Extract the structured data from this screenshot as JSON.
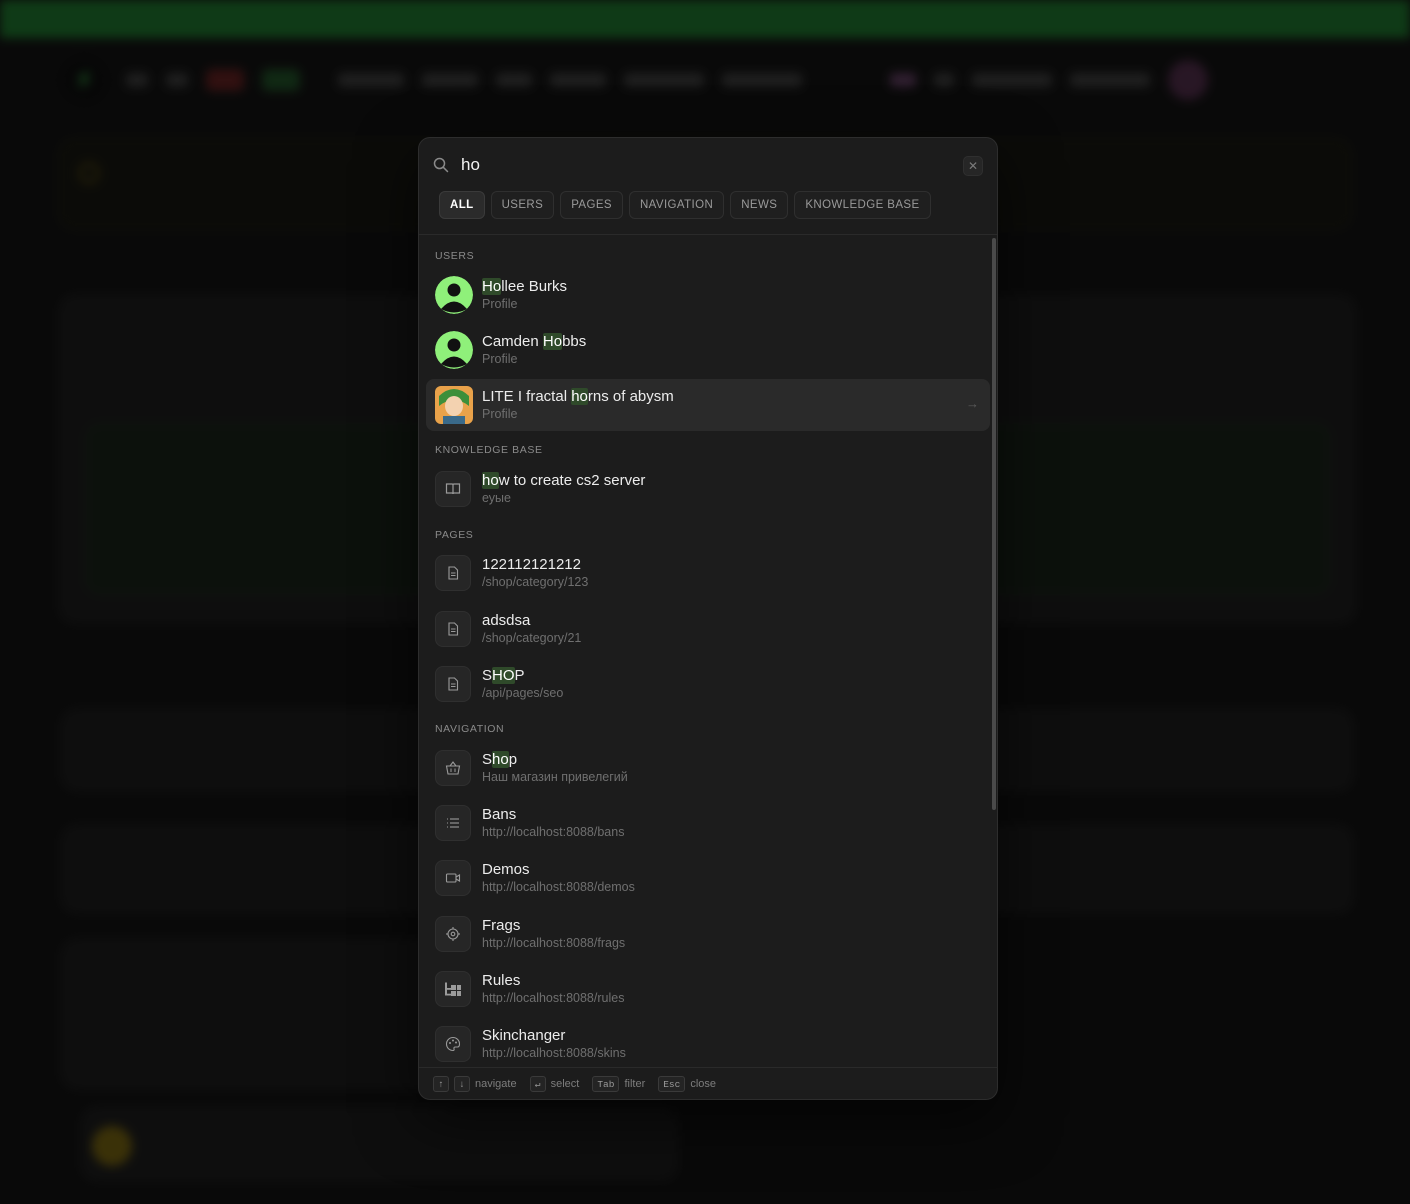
{
  "search": {
    "value": "ho",
    "placeholder": ""
  },
  "filters": [
    {
      "label": "ALL",
      "active": true
    },
    {
      "label": "USERS",
      "active": false
    },
    {
      "label": "PAGES",
      "active": false
    },
    {
      "label": "NAVIGATION",
      "active": false
    },
    {
      "label": "NEWS",
      "active": false
    },
    {
      "label": "KNOWLEDGE BASE",
      "active": false
    }
  ],
  "sections": {
    "users": "USERS",
    "knowledge_base": "KNOWLEDGE BASE",
    "pages": "PAGES",
    "navigation": "NAVIGATION"
  },
  "users": [
    {
      "pre": "",
      "match": "Ho",
      "post": "llee Burks",
      "sub": "Profile"
    },
    {
      "pre": "Camden ",
      "match": "Ho",
      "post": "bbs",
      "sub": "Profile"
    },
    {
      "pre": "LITE I fractal ",
      "match": "ho",
      "post": "rns of abysm",
      "sub": "Profile"
    }
  ],
  "knowledge_base": [
    {
      "pre": "",
      "match": "ho",
      "post": "w to create cs2 server",
      "sub": "еуые"
    }
  ],
  "pages": [
    {
      "title": "122112121212",
      "sub": "/shop/category/123"
    },
    {
      "title": "adsdsa",
      "sub": "/shop/category/21"
    },
    {
      "pre": "S",
      "match": "HO",
      "post": "P",
      "sub": "/api/pages/seo"
    }
  ],
  "navigation": [
    {
      "pre": "S",
      "match": "ho",
      "post": "p",
      "sub": "Наш магазин привелегий",
      "icon": "basket-icon"
    },
    {
      "title": "Bans",
      "sub": "http://localhost:8088/bans",
      "icon": "list-icon"
    },
    {
      "title": "Demos",
      "sub": "http://localhost:8088/demos",
      "icon": "video-icon"
    },
    {
      "title": "Frags",
      "sub": "http://localhost:8088/frags",
      "icon": "crosshair-icon"
    },
    {
      "title": "Rules",
      "sub": "http://localhost:8088/rules",
      "icon": "hierarchy-icon"
    },
    {
      "title": "Skinchanger",
      "sub": "http://localhost:8088/skins",
      "icon": "palette-icon"
    }
  ],
  "footer": {
    "up_key": "↑",
    "down_key": "↓",
    "navigate": "navigate",
    "enter_key": "↵",
    "select": "select",
    "tab_key": "Tab",
    "filter": "filter",
    "esc_key": "Esc",
    "close": "close"
  },
  "colors": {
    "accent": "#3bc34d",
    "highlight": "#2f4a2a",
    "modal_bg": "#1c1c1c"
  }
}
